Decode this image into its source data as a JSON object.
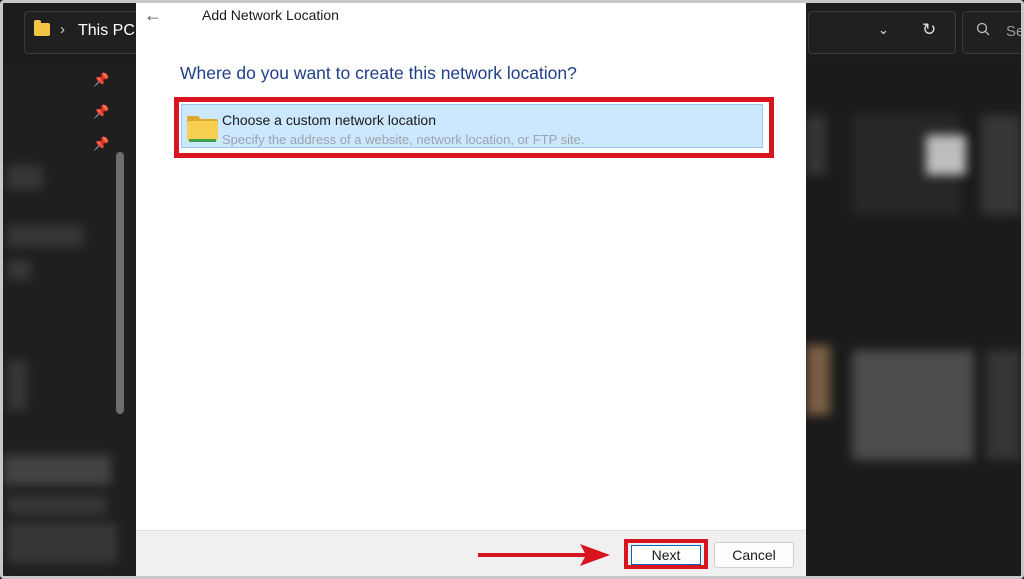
{
  "explorer": {
    "address_text": "This PC",
    "address_chevron": "›",
    "search_placeholder": "Se",
    "dropdown_glyph": "⌄",
    "refresh_glyph": "↻",
    "icons": [
      "folder-icon",
      "chevron-right-icon",
      "pin-icon",
      "chevron-down-icon",
      "refresh-icon",
      "search-icon"
    ]
  },
  "dialog": {
    "back_glyph": "←",
    "title": "Add Network Location",
    "heading": "Where do you want to create this network location?",
    "option": {
      "title": "Choose a custom network location",
      "description": "Specify the address of a website, network location, or FTP site."
    },
    "buttons": {
      "next": "Next",
      "cancel": "Cancel"
    }
  },
  "colors": {
    "annotation_red": "#d8141e",
    "heading_blue": "#1f3f8a",
    "selection_blue": "#cce8ff",
    "folder_yellow": "#f4c542"
  }
}
